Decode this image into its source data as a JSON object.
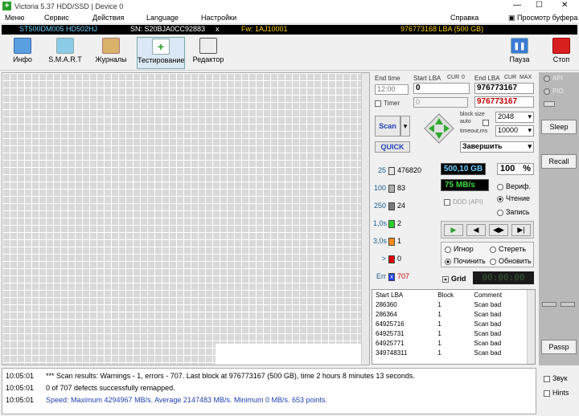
{
  "window": {
    "title": "Victoria 5.37 HDD/SSD | Device 0",
    "minimize": "—",
    "restore": "☐",
    "close": "✕"
  },
  "menu": {
    "items": [
      "Меню",
      "Сервис",
      "Действия",
      "Language",
      "Настройки"
    ],
    "help": "Справка",
    "buffer": "Просмотр буфера"
  },
  "drive": {
    "model": "ST500DM005 HD502HJ",
    "serial": "SN: S20BJA0CC92883",
    "x": "x",
    "fw": "Fw: 1AJ10001",
    "lba": "976773168 LBA (500 GB)"
  },
  "toolbar": {
    "info": "Инфо",
    "smart": "S.M.A.R.T",
    "logs": "Журналы",
    "test": "Тестирование",
    "editor": "Редактор",
    "pause": "Пауза",
    "stop": "Стоп"
  },
  "params": {
    "end_time_label": "End time",
    "end_time_value": "12:00",
    "timer_label": "Timer",
    "timer_value": "0",
    "start_lba_label": "Start LBA",
    "cur1": "CUR",
    "zero1": "0",
    "start_lba_value": "0",
    "start_lba2": "0",
    "end_lba_label": "End LBA",
    "cur2": "CUR",
    "max": "MAX",
    "end_lba_value": "976773167",
    "end_lba2": "976773167",
    "block_size_label": "block size",
    "auto_label": "auto",
    "block_size_value": "2048",
    "timeout_label": "timeout,ms",
    "timeout_value": "10000",
    "scan": "Scan",
    "quick": "QUICK",
    "finish": "Завершить"
  },
  "legend": [
    {
      "label": "25",
      "count": "476820",
      "color": "#e6e6e6"
    },
    {
      "label": "100",
      "count": "83",
      "color": "#b0b0b0"
    },
    {
      "label": "250",
      "count": "24",
      "color": "#7a7a7a"
    },
    {
      "label": "1,0s",
      "count": "2",
      "color": "#2ecc2e"
    },
    {
      "label": "3,0s",
      "count": "1",
      "color": "#ff8c1a"
    },
    {
      "label": ">",
      "count": "0",
      "color": "#e00000"
    },
    {
      "label": "Err",
      "count": "707",
      "color": "#1a3aff"
    }
  ],
  "stats": {
    "size": "500,10 GB",
    "percent": "100",
    "percent_unit": "%",
    "speed": "75 MB/s",
    "ddd": "DDD (API)",
    "verify": "Вериф.",
    "read": "Чтение",
    "write": "Запись",
    "ignore": "Игнор",
    "erase": "Стереть",
    "repair": "Починить",
    "refresh": "Обновить",
    "grid": "Grid",
    "timer": "00:00:00"
  },
  "results": {
    "headers": [
      "Start LBA",
      "Block",
      "Comment"
    ],
    "rows": [
      [
        "286360",
        "1",
        "Scan bad"
      ],
      [
        "286364",
        "1",
        "Scan bad"
      ],
      [
        "64925716",
        "1",
        "Scan bad"
      ],
      [
        "64925731",
        "1",
        "Scan bad"
      ],
      [
        "64925771",
        "1",
        "Scan bad"
      ],
      [
        "349748311",
        "1",
        "Scan bad"
      ]
    ]
  },
  "side": {
    "api": "API",
    "pio": "PIO",
    "sleep": "Sleep",
    "recall": "Recall",
    "passp": "Passp",
    "sound": "Звук",
    "hints": "Hints"
  },
  "log": [
    {
      "time": "10:05:01",
      "text": "*** Scan results: Warnings - 1, errors - 707. Last block at 976773167 (500 GB), time 2 hours 8 minutes 13 seconds.",
      "color": "#000000"
    },
    {
      "time": "10:05:01",
      "text": "0 of 707 defects successfully remapped.",
      "color": "#000000"
    },
    {
      "time": "10:05:01",
      "text": "Speed: Maximum 4294967 MB/s. Average 2147483 MB/s. Minimum 0 MB/s. 653 points.",
      "color": "#1f3fb0"
    }
  ]
}
